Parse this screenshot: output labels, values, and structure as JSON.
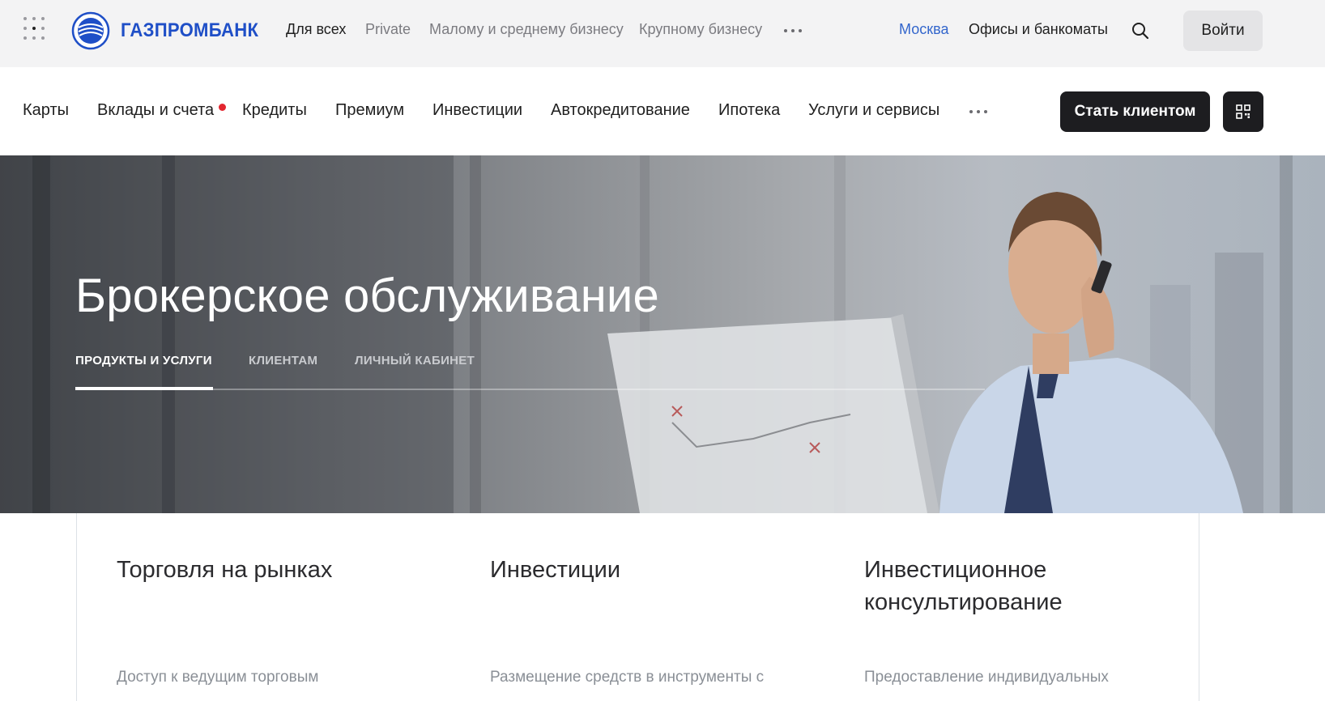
{
  "header": {
    "brand": "ГАЗПРОМБАНК",
    "segments": [
      "Для всех",
      "Private",
      "Малому и среднему бизнесу",
      "Крупному бизнесу"
    ],
    "city": "Москва",
    "offices": "Офисы и банкоматы",
    "login": "Войти"
  },
  "nav": {
    "items": [
      "Карты",
      "Вклады и счета",
      "Кредиты",
      "Премиум",
      "Инвестиции",
      "Автокредитование",
      "Ипотека",
      "Услуги и сервисы"
    ],
    "cta": "Стать клиентом"
  },
  "hero": {
    "title": "Брокерское обслуживание",
    "tabs": [
      "ПРОДУКТЫ И УСЛУГИ",
      "КЛИЕНТАМ",
      "ЛИЧНЫЙ КАБИНЕТ"
    ]
  },
  "cards": [
    {
      "title": "Торговля на рынках",
      "desc": "Доступ к ведущим торговым"
    },
    {
      "title": "Инвестиции",
      "desc": "Размещение средств в инструменты с"
    },
    {
      "title": "Инвестиционное консультирование",
      "desc": "Предоставление индивидуальных"
    }
  ],
  "colors": {
    "brand": "#1f4fc7",
    "city_link": "#3366cc",
    "notice_dot": "#e3262f",
    "dark_button": "#1d1d20"
  },
  "icons": [
    "apps-grid-icon",
    "gazprombank-logo-icon",
    "more-dots-icon",
    "search-icon",
    "qr-code-icon"
  ]
}
